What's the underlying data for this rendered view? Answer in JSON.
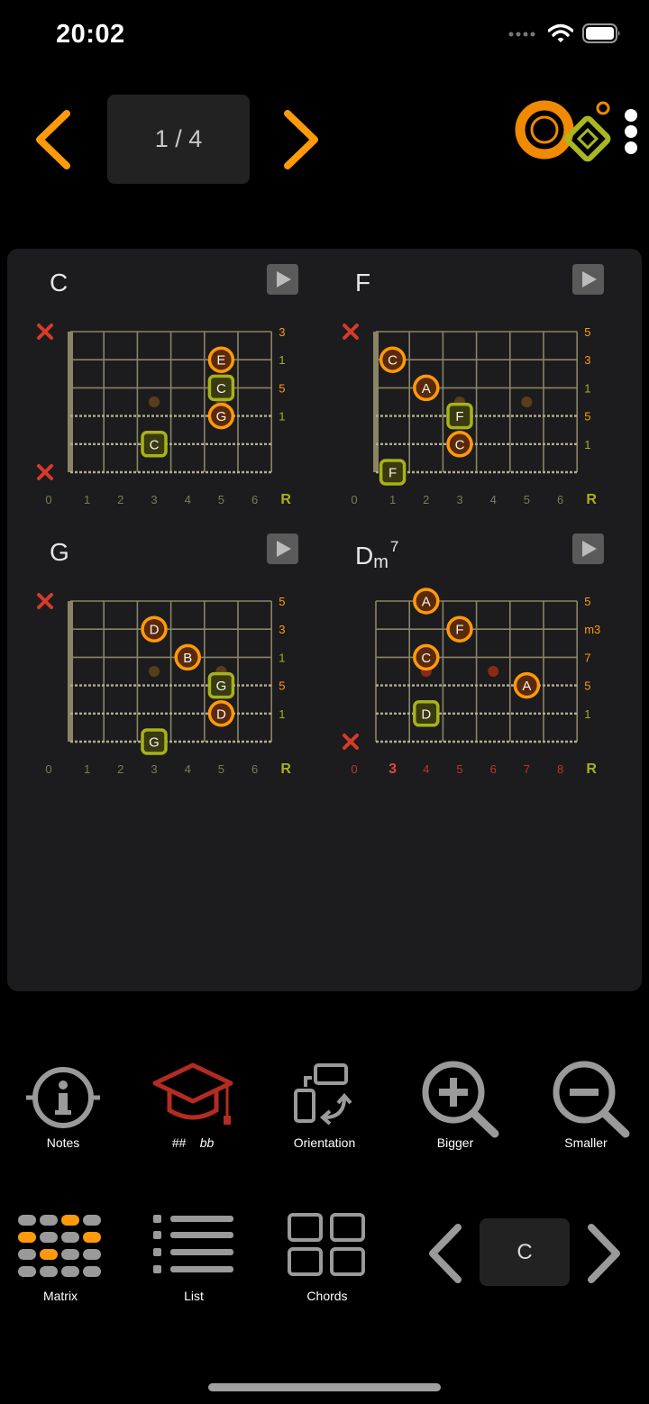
{
  "status": {
    "time": "20:02"
  },
  "header": {
    "page_indicator": "1 / 4"
  },
  "chords": [
    {
      "name": "C",
      "sub": "",
      "sup": "",
      "frets": [
        "0",
        "1",
        "2",
        "3",
        "4",
        "5",
        "6"
      ],
      "intervals": [
        "3",
        "1",
        "5",
        "1",
        ""
      ],
      "root_label": "R",
      "notes": [
        {
          "string": 1,
          "fret": 5,
          "label": "E",
          "root": false
        },
        {
          "string": 2,
          "fret": 5,
          "label": "C",
          "root": true
        },
        {
          "string": 3,
          "fret": 5,
          "label": "G",
          "root": false
        },
        {
          "string": 4,
          "fret": 3,
          "label": "C",
          "root": true
        }
      ],
      "muted": [
        0,
        5
      ]
    },
    {
      "name": "F",
      "sub": "",
      "sup": "",
      "frets": [
        "0",
        "1",
        "2",
        "3",
        "4",
        "5",
        "6"
      ],
      "intervals": [
        "5",
        "3",
        "1",
        "5",
        "1"
      ],
      "root_label": "R",
      "notes": [
        {
          "string": 1,
          "fret": 1,
          "label": "C",
          "root": false
        },
        {
          "string": 2,
          "fret": 2,
          "label": "A",
          "root": false
        },
        {
          "string": 3,
          "fret": 3,
          "label": "F",
          "root": true
        },
        {
          "string": 4,
          "fret": 3,
          "label": "C",
          "root": false
        },
        {
          "string": 5,
          "fret": 1,
          "label": "F",
          "root": true
        }
      ],
      "muted": [
        0
      ]
    },
    {
      "name": "G",
      "sub": "",
      "sup": "",
      "frets": [
        "0",
        "1",
        "2",
        "3",
        "4",
        "5",
        "6"
      ],
      "intervals": [
        "5",
        "3",
        "1",
        "5",
        "1"
      ],
      "root_label": "R",
      "notes": [
        {
          "string": 1,
          "fret": 3,
          "label": "D",
          "root": false
        },
        {
          "string": 2,
          "fret": 4,
          "label": "B",
          "root": false
        },
        {
          "string": 3,
          "fret": 5,
          "label": "G",
          "root": true
        },
        {
          "string": 4,
          "fret": 5,
          "label": "D",
          "root": false
        },
        {
          "string": 5,
          "fret": 3,
          "label": "G",
          "root": true
        }
      ],
      "muted": [
        0
      ]
    },
    {
      "name": "D",
      "sub": "m",
      "sup": "7",
      "frets": [
        "0",
        "3",
        "4",
        "5",
        "6",
        "7",
        "8"
      ],
      "intervals": [
        "5",
        "m3",
        "7",
        "5",
        "1"
      ],
      "root_label": "R",
      "notes": [
        {
          "string": 0,
          "fret": 2,
          "label": "A",
          "root": false
        },
        {
          "string": 1,
          "fret": 3,
          "label": "F",
          "root": false
        },
        {
          "string": 2,
          "fret": 2,
          "label": "C",
          "root": false
        },
        {
          "string": 3,
          "fret": 5,
          "label": "A",
          "root": false
        },
        {
          "string": 4,
          "fret": 2,
          "label": "D",
          "root": true
        }
      ],
      "muted": [
        5
      ]
    }
  ],
  "toolbar_top": [
    {
      "label": "Notes",
      "icon": "info-icon"
    },
    {
      "label": "##    bb",
      "icon": "graduation-cap-icon"
    },
    {
      "label": "Orientation",
      "icon": "orientation-icon"
    },
    {
      "label": "Bigger",
      "icon": "zoom-in-icon"
    },
    {
      "label": "Smaller",
      "icon": "zoom-out-icon"
    }
  ],
  "toolbar_bottom": [
    {
      "label": "Matrix",
      "icon": "matrix-icon"
    },
    {
      "label": "List",
      "icon": "list-icon"
    },
    {
      "label": "Chords",
      "icon": "chords-grid-icon"
    }
  ],
  "key_selector": {
    "value": "C"
  },
  "colors": {
    "accent": "#ff9a0a",
    "root": "#a7b21a",
    "mute": "#d63a2a",
    "fret_line": "#8a8466"
  }
}
